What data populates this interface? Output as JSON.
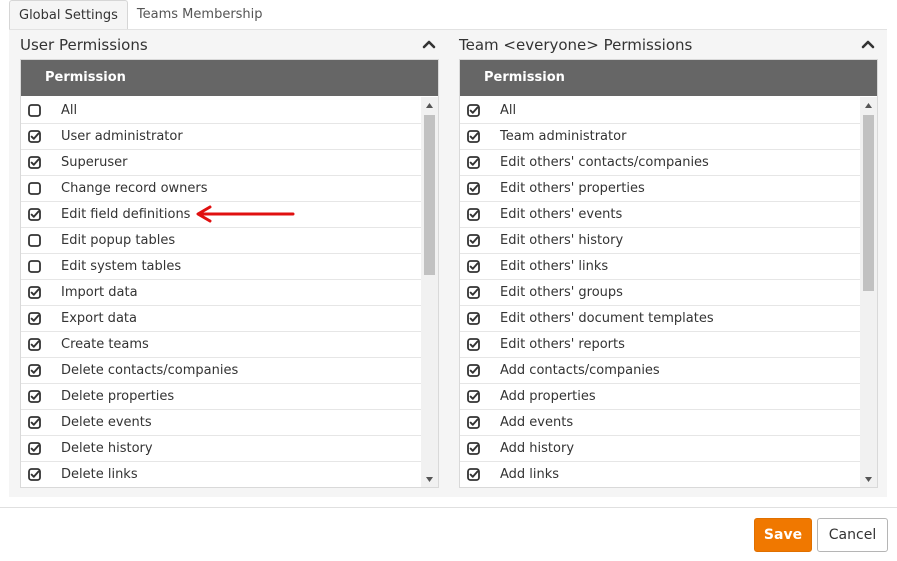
{
  "tabs": [
    {
      "label": "Global Settings",
      "active": true
    },
    {
      "label": "Teams Membership",
      "active": false
    }
  ],
  "user_panel": {
    "title": "User Permissions",
    "column_header": "Permission",
    "rows": [
      {
        "label": "All",
        "checked": false
      },
      {
        "label": "User administrator",
        "checked": true
      },
      {
        "label": "Superuser",
        "checked": true
      },
      {
        "label": "Change record owners",
        "checked": false
      },
      {
        "label": "Edit field definitions",
        "checked": true
      },
      {
        "label": "Edit popup tables",
        "checked": false
      },
      {
        "label": "Edit system tables",
        "checked": false
      },
      {
        "label": "Import data",
        "checked": true
      },
      {
        "label": "Export data",
        "checked": true
      },
      {
        "label": "Create teams",
        "checked": true
      },
      {
        "label": "Delete contacts/companies",
        "checked": true
      },
      {
        "label": "Delete properties",
        "checked": true
      },
      {
        "label": "Delete events",
        "checked": true
      },
      {
        "label": "Delete history",
        "checked": true
      },
      {
        "label": "Delete links",
        "checked": true
      }
    ],
    "scroll_position": 0.0
  },
  "team_panel": {
    "title": "Team <everyone> Permissions",
    "column_header": "Permission",
    "rows": [
      {
        "label": "All",
        "checked": true
      },
      {
        "label": "Team administrator",
        "checked": true
      },
      {
        "label": "Edit others' contacts/companies",
        "checked": true
      },
      {
        "label": "Edit others' properties",
        "checked": true
      },
      {
        "label": "Edit others' events",
        "checked": true
      },
      {
        "label": "Edit others' history",
        "checked": true
      },
      {
        "label": "Edit others' links",
        "checked": true
      },
      {
        "label": "Edit others' groups",
        "checked": true
      },
      {
        "label": "Edit others' document templates",
        "checked": true
      },
      {
        "label": "Edit others' reports",
        "checked": true
      },
      {
        "label": "Add contacts/companies",
        "checked": true
      },
      {
        "label": "Add properties",
        "checked": true
      },
      {
        "label": "Add events",
        "checked": true
      },
      {
        "label": "Add history",
        "checked": true
      },
      {
        "label": "Add links",
        "checked": true
      }
    ],
    "scroll_position": 0.0
  },
  "annotation": {
    "points_to": "Edit field definitions",
    "color": "#e01010"
  },
  "footer": {
    "save_label": "Save",
    "cancel_label": "Cancel"
  },
  "colors": {
    "accent": "#f07800",
    "grid_header": "#666666",
    "annotation_arrow": "#e01010"
  }
}
